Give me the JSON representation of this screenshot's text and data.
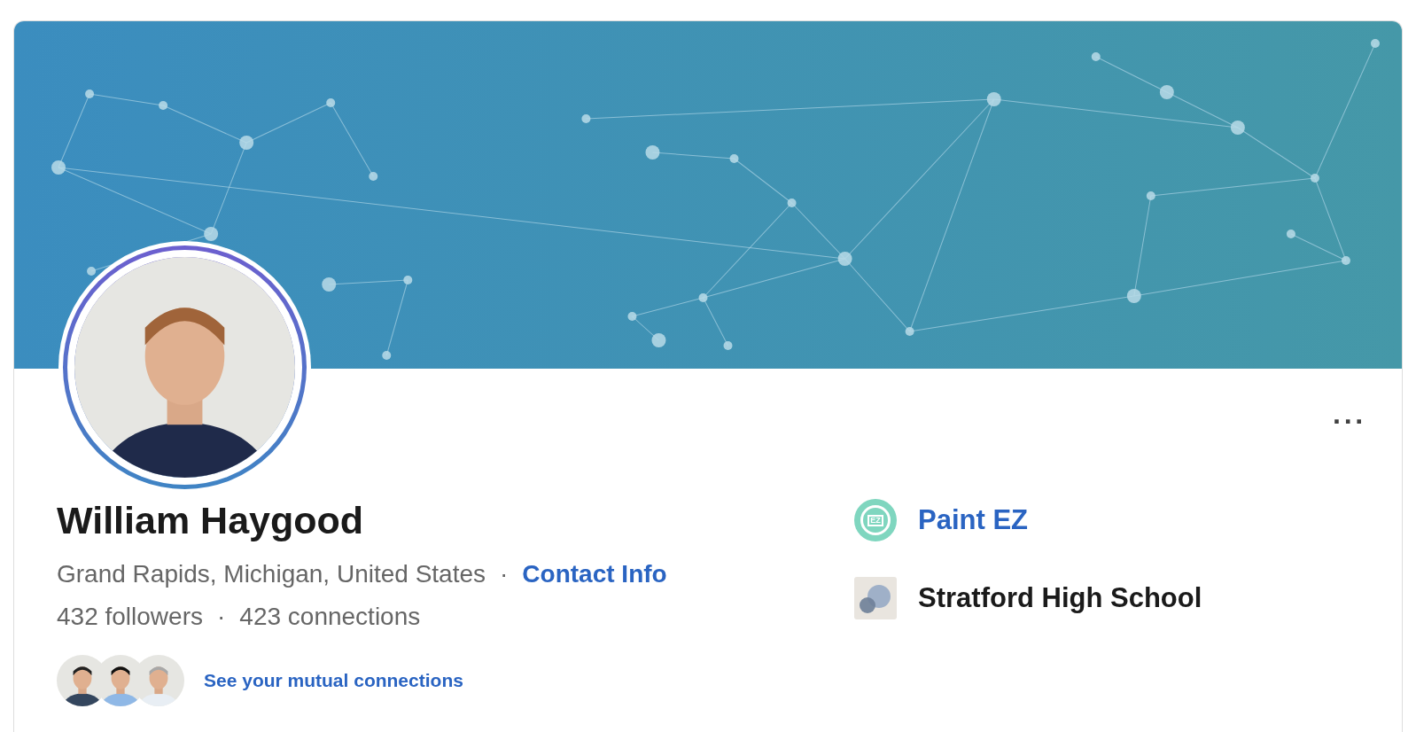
{
  "profile": {
    "name": "William Haygood",
    "location": "Grand Rapids, Michigan, United States",
    "separator": "·",
    "contact_link": "Contact Info",
    "followers": "432 followers",
    "connections": "423 connections",
    "mutual_link": "See your mutual connections"
  },
  "more_button": "···",
  "affiliations": [
    {
      "kind": "company",
      "name": "Paint EZ",
      "logo_text": "EZ"
    },
    {
      "kind": "school",
      "name": "Stratford High School"
    }
  ]
}
